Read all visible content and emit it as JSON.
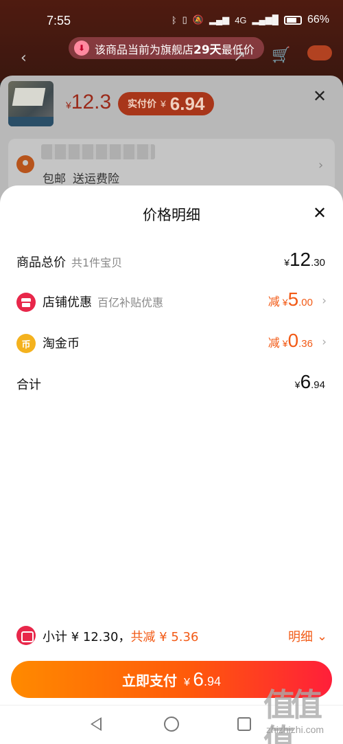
{
  "status_bar": {
    "time": "7:55",
    "battery": "66%",
    "network": "4G"
  },
  "promo": {
    "text": "该商品当前为旗舰店",
    "highlight": "29天",
    "suffix": "最低价"
  },
  "product": {
    "currency": "¥",
    "price": "12.3",
    "pay_label": "实付价",
    "pay_currency": "¥",
    "pay_amount": "6.94"
  },
  "address": {
    "tags": [
      "包邮",
      "送运费险"
    ]
  },
  "modal": {
    "title": "价格明细",
    "rows": [
      {
        "label": "商品总价",
        "sub": "共1件宝贝",
        "prefix": "",
        "currency": "¥",
        "int": "12",
        "dec": ".30"
      },
      {
        "label": "店铺优惠",
        "sub": "百亿补贴优惠",
        "prefix": "减",
        "currency": "¥",
        "int": "5",
        "dec": ".00",
        "icon": "store-icon"
      },
      {
        "label": "淘金币",
        "sub": "",
        "prefix": "减",
        "currency": "¥",
        "int": "0",
        "dec": ".36",
        "icon": "coin-icon"
      },
      {
        "label": "合计",
        "sub": "",
        "prefix": "",
        "currency": "¥",
        "int": "6",
        "dec": ".94"
      }
    ]
  },
  "summary": {
    "text": "小计 ¥ 12.30，",
    "cut_text": "共减 ¥ 5.36",
    "detail_label": "明细"
  },
  "pay_button": {
    "label": "立即支付",
    "currency": "¥",
    "int": "6",
    "dec": ".94"
  },
  "watermark": {
    "big": "值值值",
    "small": "zhizhizhi.com"
  },
  "colors": {
    "accent": "#f25a16",
    "brand_red": "#e8274a",
    "coin": "#f4b21e"
  }
}
